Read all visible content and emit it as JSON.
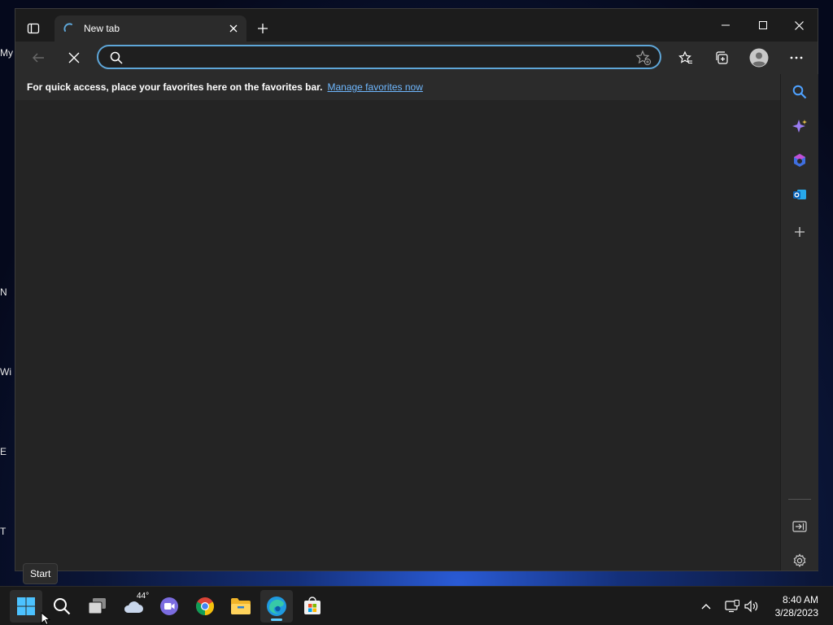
{
  "desktop": {
    "edge_labels": [
      "My",
      "N",
      "Wi",
      "E",
      "T"
    ]
  },
  "browser": {
    "tab": {
      "title": "New tab"
    },
    "address": {
      "value": "",
      "placeholder": ""
    },
    "favorites_bar": {
      "message": "For quick access, place your favorites here on the favorites bar.",
      "link": "Manage favorites now"
    },
    "accent": "#5ea6d8"
  },
  "tooltip": {
    "text": "Start"
  },
  "taskbar": {
    "weather_temp": "44°",
    "apps": [
      "start-icon",
      "search-icon",
      "task-view-icon",
      "weather-icon",
      "teams-chat-icon",
      "chrome-icon",
      "file-explorer-icon",
      "edge-icon",
      "store-icon"
    ]
  },
  "clock": {
    "time": "8:40 AM",
    "date": "3/28/2023"
  }
}
